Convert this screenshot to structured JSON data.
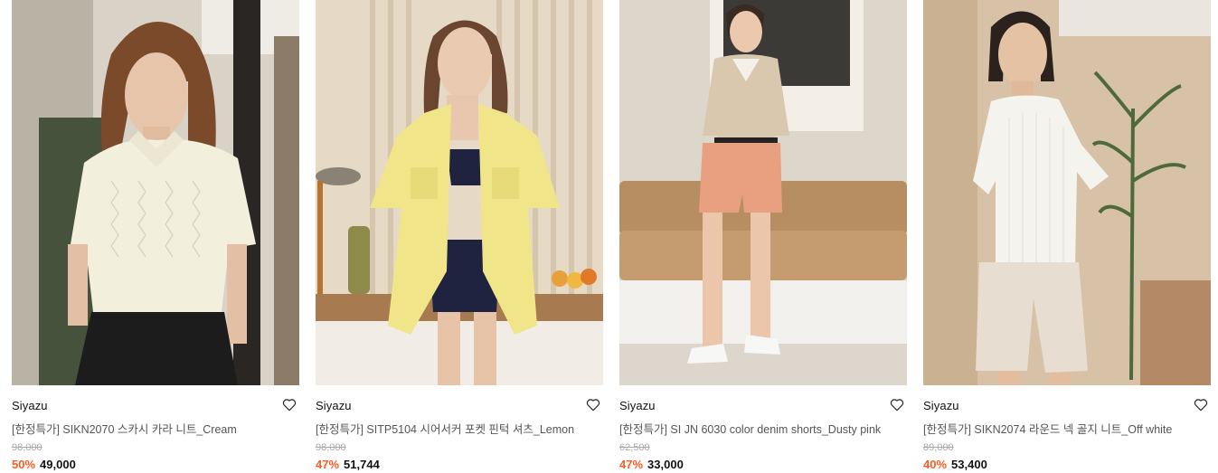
{
  "products": [
    {
      "brand": "Siyazu",
      "title": "[한정특가] SIKN2070 스카시 카라 니트_Cream",
      "original_price": "98,000",
      "discount": "50%",
      "price": "49,000",
      "wishlist_icon": "heart-outline-icon"
    },
    {
      "brand": "Siyazu",
      "title": "[한정특가] SITP5104 시어서커 포켓 핀턱 셔츠_Lemon",
      "original_price": "98,000",
      "discount": "47%",
      "price": "51,744",
      "wishlist_icon": "heart-outline-icon"
    },
    {
      "brand": "Siyazu",
      "title": "[한정특가] SI JN 6030 color denim shorts_Dusty pink",
      "original_price": "62,500",
      "discount": "47%",
      "price": "33,000",
      "wishlist_icon": "heart-outline-icon"
    },
    {
      "brand": "Siyazu",
      "title": "[한정특가] SIKN2074 라운드 넥 골지 니트_Off white",
      "original_price": "89,000",
      "discount": "40%",
      "price": "53,400",
      "wishlist_icon": "heart-outline-icon"
    }
  ],
  "colors": {
    "discount": "#ff5a1f",
    "original_price": "#aaaaaa",
    "title": "#555555"
  }
}
